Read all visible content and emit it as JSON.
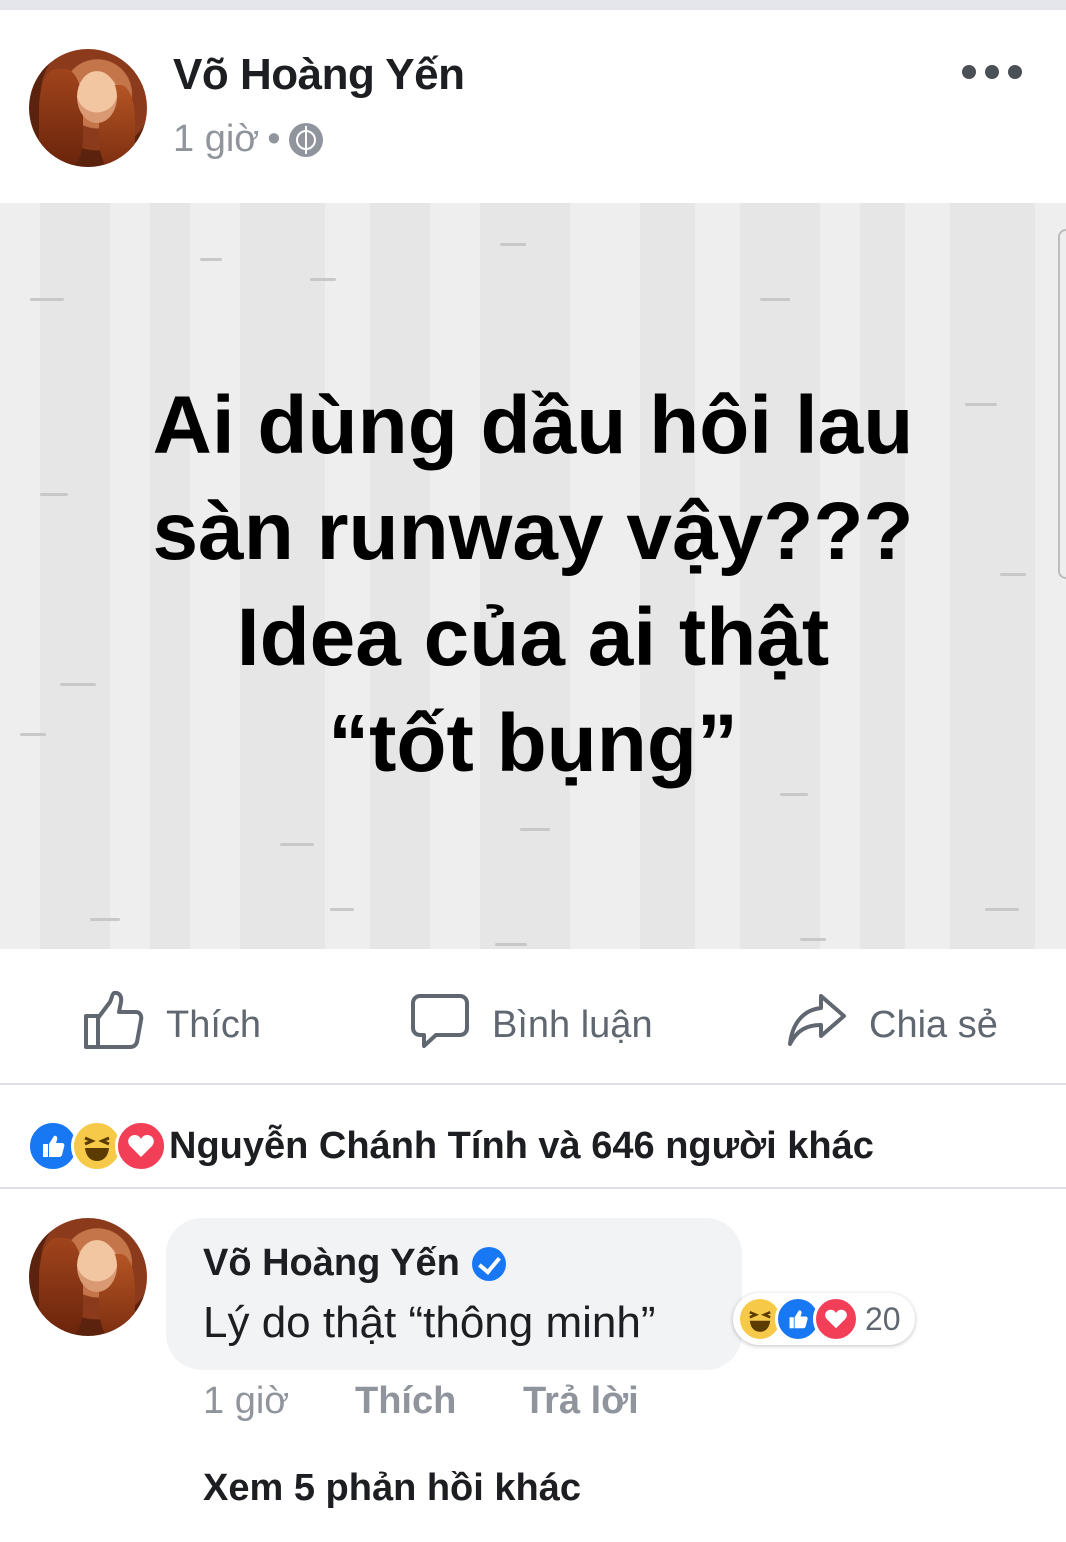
{
  "post": {
    "author": "Võ Hoàng Yến",
    "time": "1 giờ",
    "separator": "•",
    "privacy_icon": "globe-icon",
    "text_lines": [
      "Ai dùng dầu hôi lau",
      "sàn runway vậy???",
      "Idea của ai thật",
      "“tốt bụng”"
    ]
  },
  "actions": {
    "like": "Thích",
    "comment": "Bình luận",
    "share": "Chia sẻ"
  },
  "reactions": {
    "summary": "Nguyễn Chánh Tính và 646 người khác",
    "icons": [
      "like-icon",
      "haha-icon",
      "love-icon"
    ]
  },
  "comment": {
    "author": "Võ Hoàng Yến",
    "verified": true,
    "text": "Lý do thật “thông minh”",
    "reaction_count": "20",
    "time": "1 giờ",
    "like_label": "Thích",
    "reply_label": "Trả lời",
    "more_replies": "Xem 5 phản hồi khác"
  },
  "colors": {
    "like_blue": "#1877f2",
    "love_red": "#f33e58",
    "haha_yellow": "#f7c948",
    "text_dark": "#1c1e21",
    "text_gray": "#90949c",
    "post_background": "#eeeeee"
  }
}
